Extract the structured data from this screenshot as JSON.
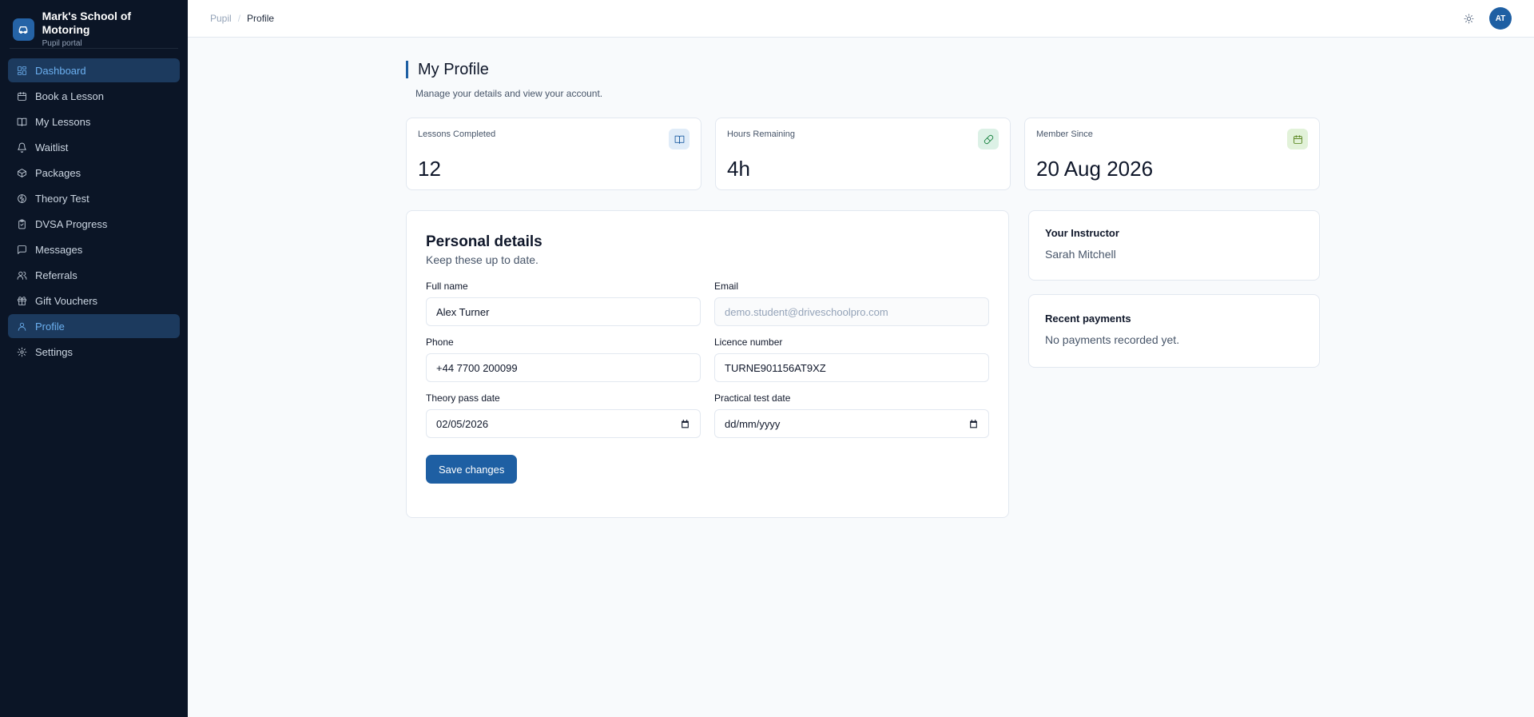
{
  "brand": {
    "name": "Mark's School of Motoring",
    "subtitle": "Pupil portal"
  },
  "nav": [
    {
      "label": "Dashboard",
      "icon": "dashboard-icon",
      "active": true
    },
    {
      "label": "Book a Lesson",
      "icon": "calendar-icon",
      "active": false
    },
    {
      "label": "My Lessons",
      "icon": "book-icon",
      "active": false
    },
    {
      "label": "Waitlist",
      "icon": "bell-icon",
      "active": false
    },
    {
      "label": "Packages",
      "icon": "package-icon",
      "active": false
    },
    {
      "label": "Theory Test",
      "icon": "brain-icon",
      "active": false
    },
    {
      "label": "DVSA Progress",
      "icon": "clipboard-icon",
      "active": false
    },
    {
      "label": "Messages",
      "icon": "message-icon",
      "active": false
    },
    {
      "label": "Referrals",
      "icon": "users-icon",
      "active": false
    },
    {
      "label": "Gift Vouchers",
      "icon": "gift-icon",
      "active": false
    },
    {
      "label": "Profile",
      "icon": "user-icon",
      "active": true
    },
    {
      "label": "Settings",
      "icon": "gear-icon",
      "active": false
    }
  ],
  "header": {
    "breadcrumb_root": "Pupil",
    "breadcrumb_sep": "/",
    "breadcrumb_current": "Profile",
    "avatar_initials": "AT"
  },
  "page": {
    "title": "My Profile",
    "subtitle": "Manage your details and view your account."
  },
  "stats": [
    {
      "label": "Lessons Completed",
      "value": "12",
      "icon": "book-open-icon",
      "icon_bg": "#e0ecf8",
      "icon_color": "#1e5fa3"
    },
    {
      "label": "Hours Remaining",
      "value": "4h",
      "icon": "pill-icon",
      "icon_bg": "#dcf1e6",
      "icon_color": "#15803d"
    },
    {
      "label": "Member Since",
      "value": "20 Aug 2026",
      "icon": "calendar-icon",
      "icon_bg": "#e2f2d9",
      "icon_color": "#4d7c0f"
    }
  ],
  "form": {
    "title": "Personal details",
    "subtitle": "Keep these up to date.",
    "full_name_label": "Full name",
    "full_name_value": "Alex Turner",
    "email_label": "Email",
    "email_value": "demo.student@driveschoolpro.com",
    "phone_label": "Phone",
    "phone_value": "+44 7700 200099",
    "licence_label": "Licence number",
    "licence_value": "TURNE901156AT9XZ",
    "theory_label": "Theory pass date",
    "theory_value": "02/05/2026",
    "practical_label": "Practical test date",
    "practical_placeholder": "dd/mm/yyyy",
    "save_label": "Save changes"
  },
  "instructor": {
    "title": "Your Instructor",
    "name": "Sarah Mitchell"
  },
  "payments": {
    "title": "Recent payments",
    "empty": "No payments recorded yet."
  }
}
